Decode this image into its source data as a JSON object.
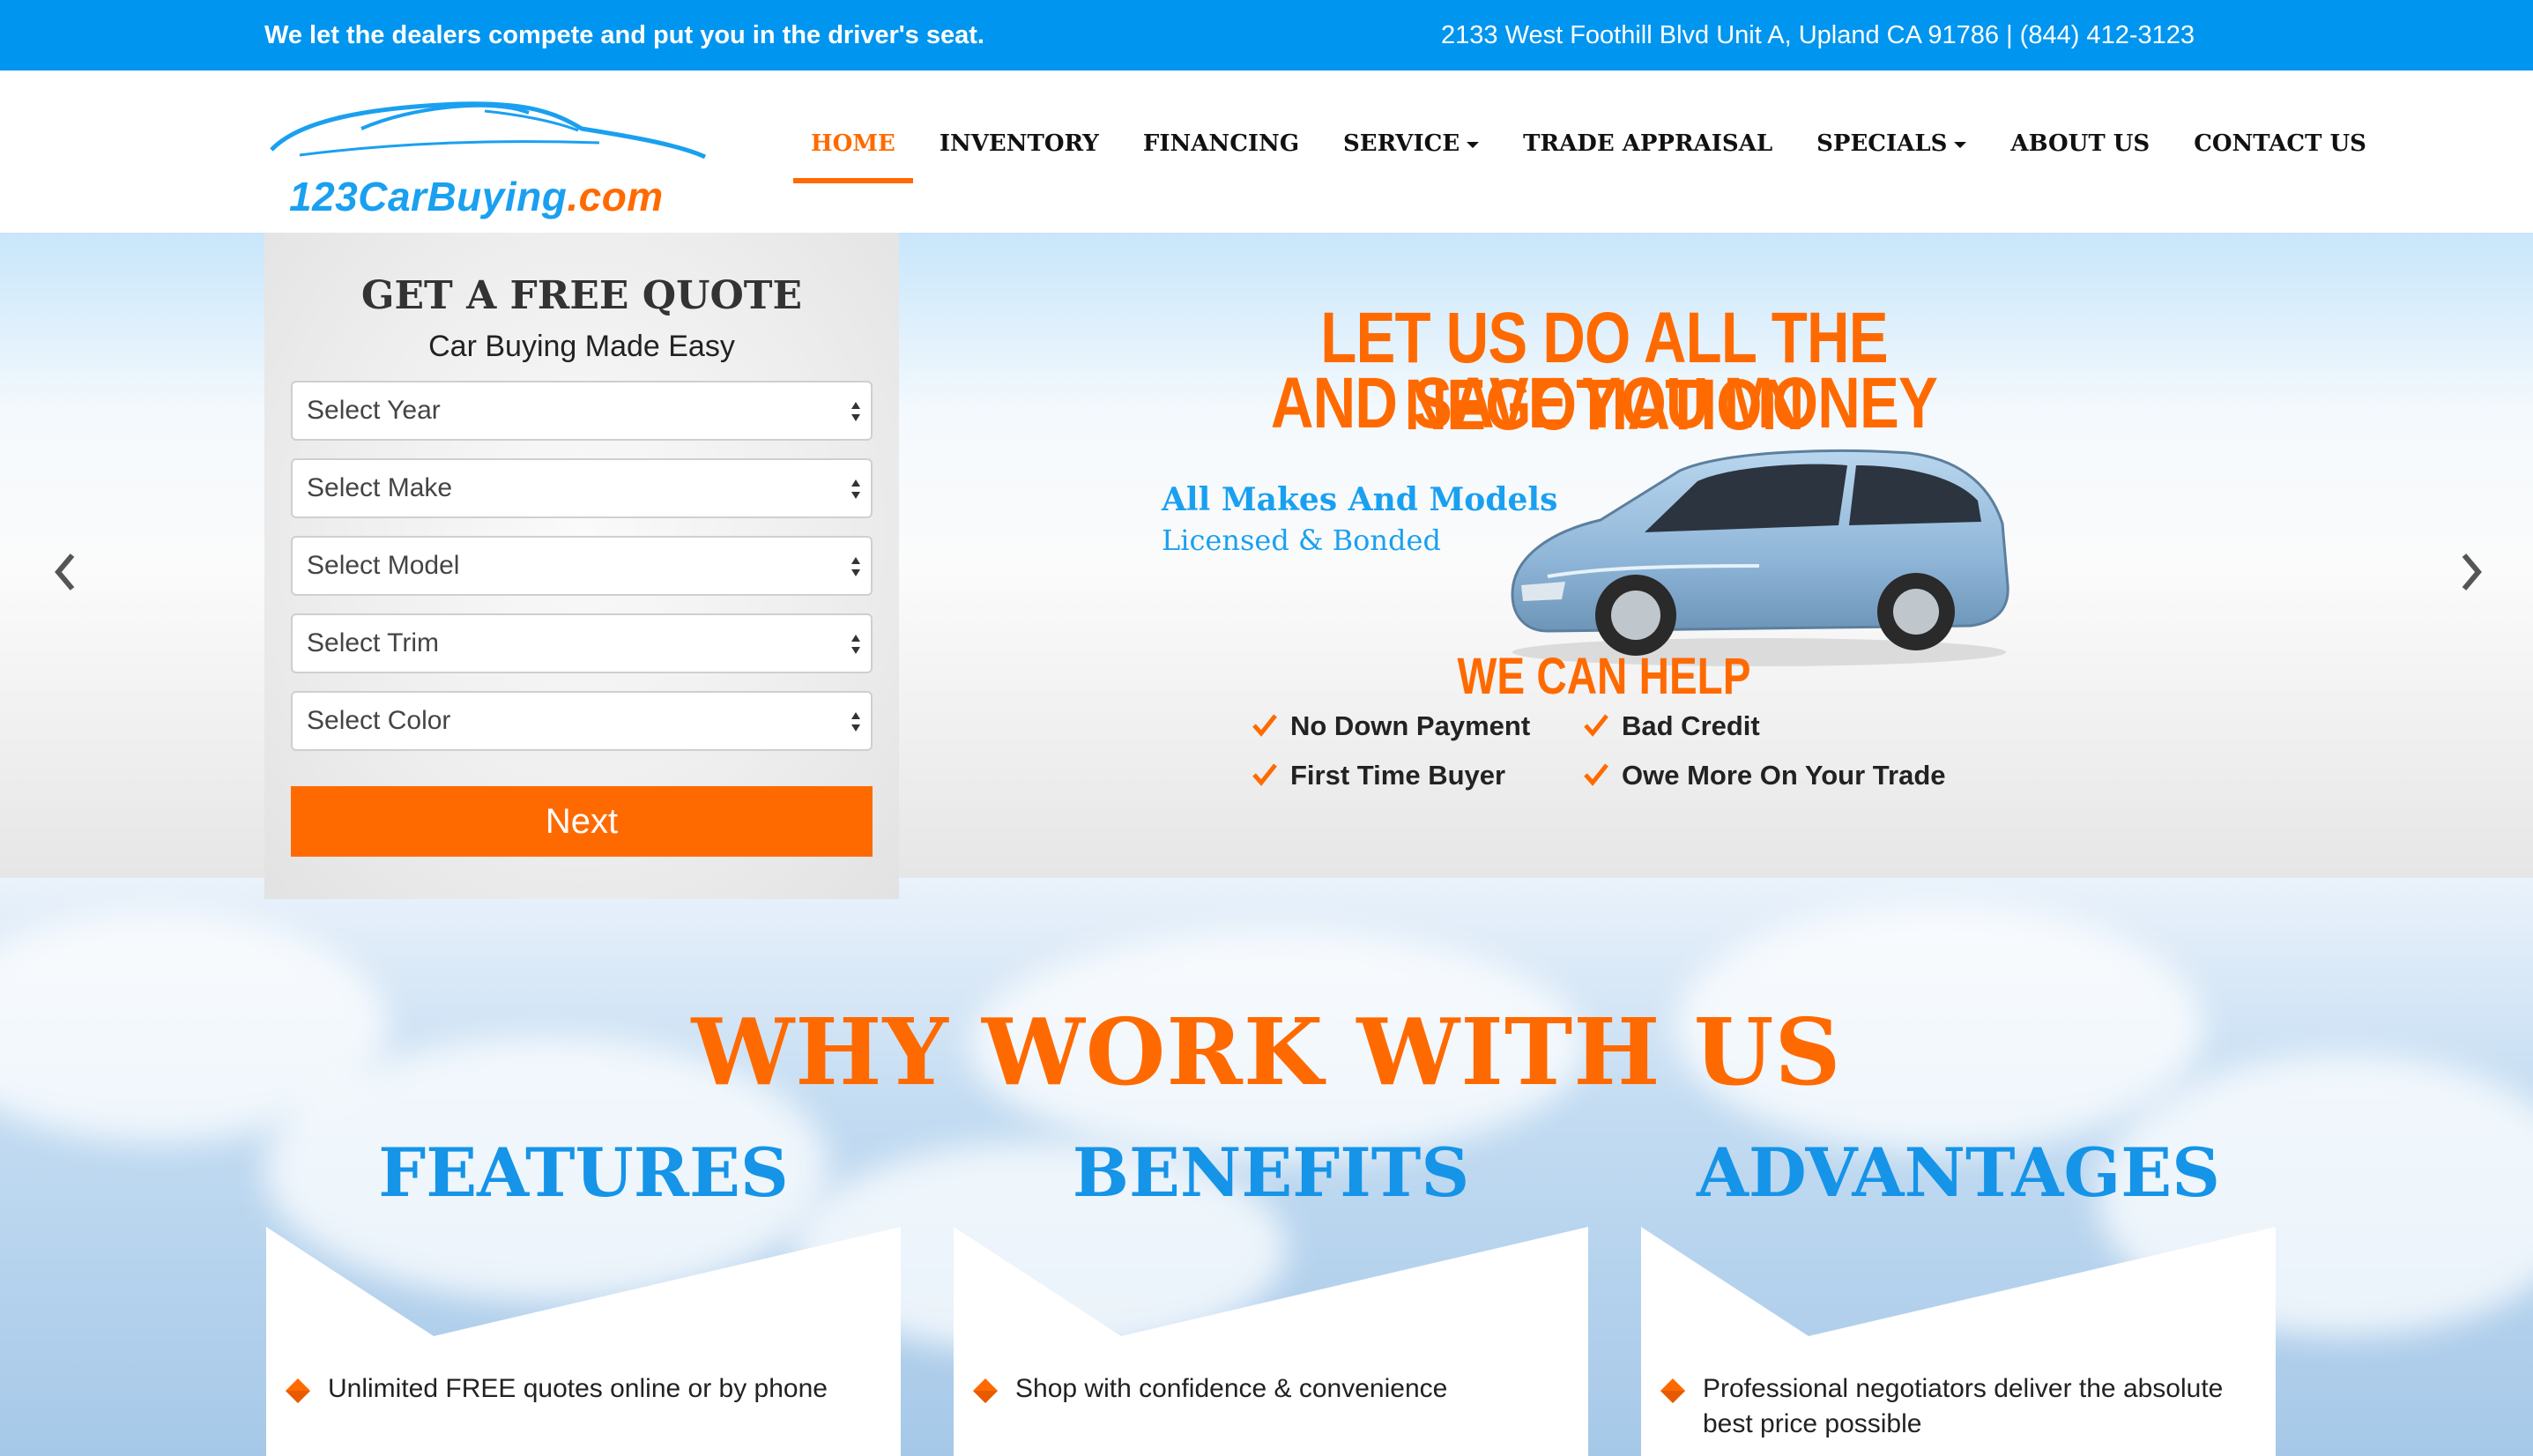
{
  "topbar": {
    "tagline": "We let the dealers compete and put you in the driver's seat.",
    "contact": "2133 West Foothill Blvd Unit A, Upland CA 91786 | (844) 412-3123"
  },
  "logo": {
    "text_main": "123CarBuying",
    "text_dot": ".com"
  },
  "nav": {
    "items": [
      {
        "label": "HOME",
        "active": true
      },
      {
        "label": "INVENTORY"
      },
      {
        "label": "FINANCING"
      },
      {
        "label": "SERVICE",
        "dropdown": true
      },
      {
        "label": "TRADE APPRAISAL"
      },
      {
        "label": "SPECIALS",
        "dropdown": true
      },
      {
        "label": "ABOUT US"
      },
      {
        "label": "CONTACT US"
      }
    ]
  },
  "quote": {
    "title": "GET A FREE QUOTE",
    "subtitle": "Car Buying Made Easy",
    "selects": [
      "Select Year",
      "Select Make",
      "Select Model",
      "Select Trim",
      "Select Color"
    ],
    "next_label": "Next"
  },
  "promo": {
    "headline_line1": "LET US DO ALL THE NEGOTIATION",
    "headline_line2": "AND SAVE YOU MONEY",
    "makes": "All Makes And Models",
    "bonded": "Licensed & Bonded",
    "help": "WE CAN HELP",
    "checks": [
      "No Down Payment",
      "Bad Credit",
      "First Time Buyer",
      "Owe More On Your Trade"
    ]
  },
  "why": {
    "title": "WHY WORK WITH US",
    "columns": [
      {
        "title": "FEATURES",
        "item": "Unlimited FREE quotes online or by phone"
      },
      {
        "title": "BENEFITS",
        "item": "Shop with confidence & convenience"
      },
      {
        "title": "ADVANTAGES",
        "item": "Professional negotiators deliver the absolute best price possible"
      }
    ]
  },
  "colors": {
    "brand_blue": "#0095ef",
    "brand_orange": "#ff6a00",
    "heading_blue": "#1594e8"
  },
  "icons": {
    "carousel_prev": "chevron-left-icon",
    "carousel_next": "chevron-right-icon",
    "check": "check-icon",
    "bullet": "diamond-icon",
    "select_arrows": "updown-icon"
  }
}
